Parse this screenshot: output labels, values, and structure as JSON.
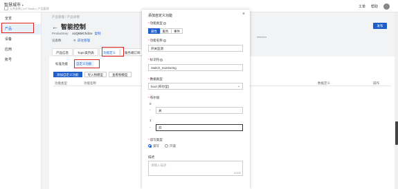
{
  "topbar": {
    "brand": "智慧城市",
    "brand_sub": "公共实例 | IoT Studio | 产品管理",
    "right_items": [
      "工单",
      "帮助"
    ]
  },
  "sidebar": {
    "items": [
      {
        "label": "全览"
      },
      {
        "label": "产品"
      },
      {
        "label": "设备"
      },
      {
        "label": "应用"
      },
      {
        "label": "账号"
      }
    ]
  },
  "main": {
    "breadcrumb": "产品管理 / 产品详情",
    "title": "智能控制",
    "back_arrow": "←",
    "publish_label": "发布",
    "product_key_label": "ProductKey",
    "product_key_value": "a1QBMChdize",
    "copy_label": "复制",
    "device_count_label": "设备数",
    "device_count_value": "0",
    "device_link": "前往管理",
    "secret_value": "********",
    "tabs": [
      "产品信息",
      "Topic类列表",
      "功能定义",
      "服务端订阅"
    ],
    "subtabs": [
      "标准功能",
      "自定义功能"
    ],
    "buttons": [
      "添加自定义功能",
      "导入物模型",
      "查看物模型"
    ],
    "table_headers": [
      "功能类型",
      "功能名称",
      "数据定义",
      "操作"
    ]
  },
  "modal": {
    "title": "添加自定义功能",
    "close": "×",
    "func_type_label": "功能类型",
    "func_type_options": [
      "属性",
      "服务",
      "事件"
    ],
    "func_name_label": "功能名称",
    "func_name_value": "开关监测",
    "identifier_label": "标识符",
    "identifier_value": "Switch_monitoring",
    "data_type_label": "数据类型",
    "data_type_value": "bool (布尔型)",
    "bool_label": "布尔值",
    "bool_0_num": "0",
    "bool_0_value": "关",
    "bool_1_num": "1",
    "bool_1_value": "开",
    "dash": "-",
    "rw_label": "读写类型",
    "rw_options": [
      "读写",
      "只读"
    ],
    "desc_label": "描述",
    "desc_placeholder": "请输入描述",
    "desc_counter": "0/100"
  },
  "colors": {
    "primary": "#1f5ec9",
    "highlight": "#e02020"
  }
}
